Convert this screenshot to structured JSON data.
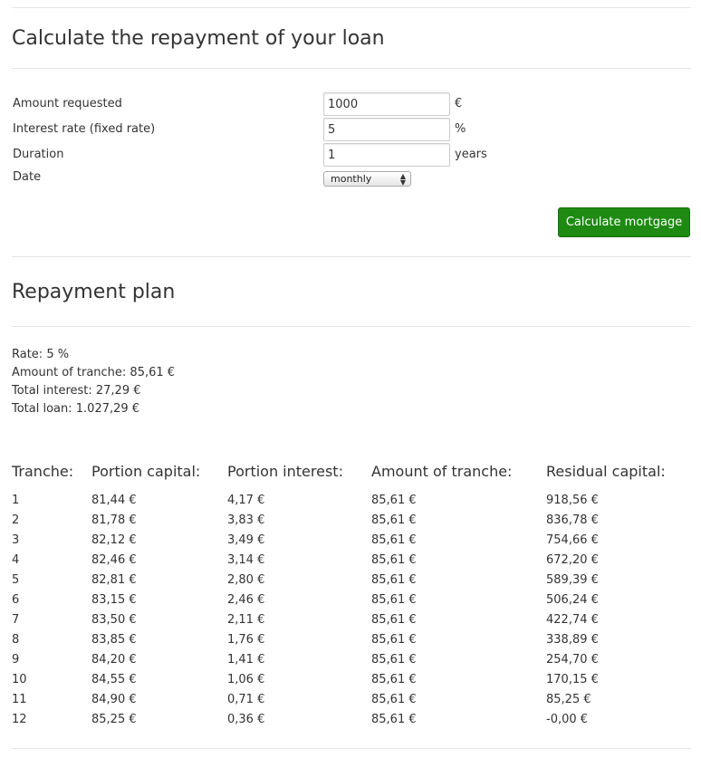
{
  "calculator": {
    "title": "Calculate the repayment of your loan",
    "fields": {
      "amount": {
        "label": "Amount requested",
        "value": "1000",
        "unit": "€"
      },
      "interest": {
        "label": "Interest rate (fixed rate)",
        "value": "5",
        "unit": "%"
      },
      "duration": {
        "label": "Duration",
        "value": "1",
        "unit": "years"
      },
      "date": {
        "label": "Date",
        "selected": "monthly"
      }
    },
    "submit_label": "Calculate mortgage",
    "button_color": "#1e8a12"
  },
  "plan": {
    "title": "Repayment plan",
    "summary": {
      "rate": "Rate: 5 %",
      "tranche_amount": "Amount of tranche: 85,61 €",
      "total_interest": "Total interest: 27,29 €",
      "total_loan": "Total loan: 1.027,29 €"
    },
    "columns": [
      "Tranche:",
      "Portion capital:",
      "Portion interest:",
      "Amount of tranche:",
      "Residual capital:"
    ],
    "rows": [
      [
        "1",
        "81,44 €",
        "4,17 €",
        "85,61 €",
        "918,56 €"
      ],
      [
        "2",
        "81,78 €",
        "3,83 €",
        "85,61 €",
        "836,78 €"
      ],
      [
        "3",
        "82,12 €",
        "3,49 €",
        "85,61 €",
        "754,66 €"
      ],
      [
        "4",
        "82,46 €",
        "3,14 €",
        "85,61 €",
        "672,20 €"
      ],
      [
        "5",
        "82,81 €",
        "2,80 €",
        "85,61 €",
        "589,39 €"
      ],
      [
        "6",
        "83,15 €",
        "2,46 €",
        "85,61 €",
        "506,24 €"
      ],
      [
        "7",
        "83,50 €",
        "2,11 €",
        "85,61 €",
        "422,74 €"
      ],
      [
        "8",
        "83,85 €",
        "1,76 €",
        "85,61 €",
        "338,89 €"
      ],
      [
        "9",
        "84,20 €",
        "1,41 €",
        "85,61 €",
        "254,70 €"
      ],
      [
        "10",
        "84,55 €",
        "1,06 €",
        "85,61 €",
        "170,15 €"
      ],
      [
        "11",
        "84,90 €",
        "0,71 €",
        "85,61 €",
        "85,25 €"
      ],
      [
        "12",
        "85,25 €",
        "0,36 €",
        "85,61 €",
        "-0,00 €"
      ]
    ]
  }
}
